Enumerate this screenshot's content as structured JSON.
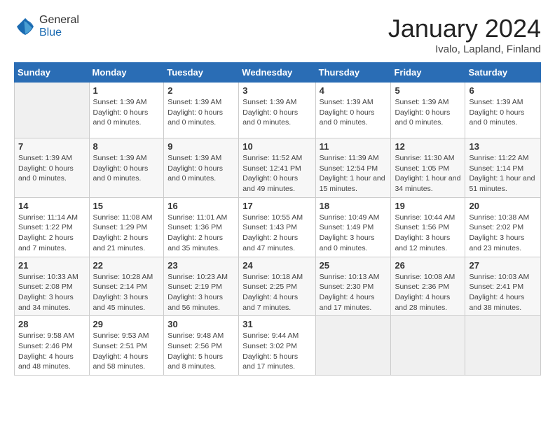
{
  "header": {
    "logo_general": "General",
    "logo_blue": "Blue",
    "month_title": "January 2024",
    "location": "Ivalo, Lapland, Finland"
  },
  "days_of_week": [
    "Sunday",
    "Monday",
    "Tuesday",
    "Wednesday",
    "Thursday",
    "Friday",
    "Saturday"
  ],
  "weeks": [
    [
      {
        "day": "",
        "info": ""
      },
      {
        "day": "1",
        "info": "Sunset: 1:39 AM\nDaylight: 0 hours and 0 minutes."
      },
      {
        "day": "2",
        "info": "Sunset: 1:39 AM\nDaylight: 0 hours and 0 minutes."
      },
      {
        "day": "3",
        "info": "Sunset: 1:39 AM\nDaylight: 0 hours and 0 minutes."
      },
      {
        "day": "4",
        "info": "Sunset: 1:39 AM\nDaylight: 0 hours and 0 minutes."
      },
      {
        "day": "5",
        "info": "Sunset: 1:39 AM\nDaylight: 0 hours and 0 minutes."
      },
      {
        "day": "6",
        "info": "Sunset: 1:39 AM\nDaylight: 0 hours and 0 minutes."
      }
    ],
    [
      {
        "day": "7",
        "info": "Sunset: 1:39 AM\nDaylight: 0 hours and 0 minutes."
      },
      {
        "day": "8",
        "info": "Sunset: 1:39 AM\nDaylight: 0 hours and 0 minutes."
      },
      {
        "day": "9",
        "info": "Sunset: 1:39 AM\nDaylight: 0 hours and 0 minutes."
      },
      {
        "day": "10",
        "info": "Sunrise: 11:52 AM\nSunset: 12:41 PM\nDaylight: 0 hours and 49 minutes."
      },
      {
        "day": "11",
        "info": "Sunrise: 11:39 AM\nSunset: 12:54 PM\nDaylight: 1 hour and 15 minutes."
      },
      {
        "day": "12",
        "info": "Sunrise: 11:30 AM\nSunset: 1:05 PM\nDaylight: 1 hour and 34 minutes."
      },
      {
        "day": "13",
        "info": "Sunrise: 11:22 AM\nSunset: 1:14 PM\nDaylight: 1 hour and 51 minutes."
      }
    ],
    [
      {
        "day": "14",
        "info": "Sunrise: 11:14 AM\nSunset: 1:22 PM\nDaylight: 2 hours and 7 minutes."
      },
      {
        "day": "15",
        "info": "Sunrise: 11:08 AM\nSunset: 1:29 PM\nDaylight: 2 hours and 21 minutes."
      },
      {
        "day": "16",
        "info": "Sunrise: 11:01 AM\nSunset: 1:36 PM\nDaylight: 2 hours and 35 minutes."
      },
      {
        "day": "17",
        "info": "Sunrise: 10:55 AM\nSunset: 1:43 PM\nDaylight: 2 hours and 47 minutes."
      },
      {
        "day": "18",
        "info": "Sunrise: 10:49 AM\nSunset: 1:49 PM\nDaylight: 3 hours and 0 minutes."
      },
      {
        "day": "19",
        "info": "Sunrise: 10:44 AM\nSunset: 1:56 PM\nDaylight: 3 hours and 12 minutes."
      },
      {
        "day": "20",
        "info": "Sunrise: 10:38 AM\nSunset: 2:02 PM\nDaylight: 3 hours and 23 minutes."
      }
    ],
    [
      {
        "day": "21",
        "info": "Sunrise: 10:33 AM\nSunset: 2:08 PM\nDaylight: 3 hours and 34 minutes."
      },
      {
        "day": "22",
        "info": "Sunrise: 10:28 AM\nSunset: 2:14 PM\nDaylight: 3 hours and 45 minutes."
      },
      {
        "day": "23",
        "info": "Sunrise: 10:23 AM\nSunset: 2:19 PM\nDaylight: 3 hours and 56 minutes."
      },
      {
        "day": "24",
        "info": "Sunrise: 10:18 AM\nSunset: 2:25 PM\nDaylight: 4 hours and 7 minutes."
      },
      {
        "day": "25",
        "info": "Sunrise: 10:13 AM\nSunset: 2:30 PM\nDaylight: 4 hours and 17 minutes."
      },
      {
        "day": "26",
        "info": "Sunrise: 10:08 AM\nSunset: 2:36 PM\nDaylight: 4 hours and 28 minutes."
      },
      {
        "day": "27",
        "info": "Sunrise: 10:03 AM\nSunset: 2:41 PM\nDaylight: 4 hours and 38 minutes."
      }
    ],
    [
      {
        "day": "28",
        "info": "Sunrise: 9:58 AM\nSunset: 2:46 PM\nDaylight: 4 hours and 48 minutes."
      },
      {
        "day": "29",
        "info": "Sunrise: 9:53 AM\nSunset: 2:51 PM\nDaylight: 4 hours and 58 minutes."
      },
      {
        "day": "30",
        "info": "Sunrise: 9:48 AM\nSunset: 2:56 PM\nDaylight: 5 hours and 8 minutes."
      },
      {
        "day": "31",
        "info": "Sunrise: 9:44 AM\nSunset: 3:02 PM\nDaylight: 5 hours and 17 minutes."
      },
      {
        "day": "",
        "info": ""
      },
      {
        "day": "",
        "info": ""
      },
      {
        "day": "",
        "info": ""
      }
    ]
  ]
}
